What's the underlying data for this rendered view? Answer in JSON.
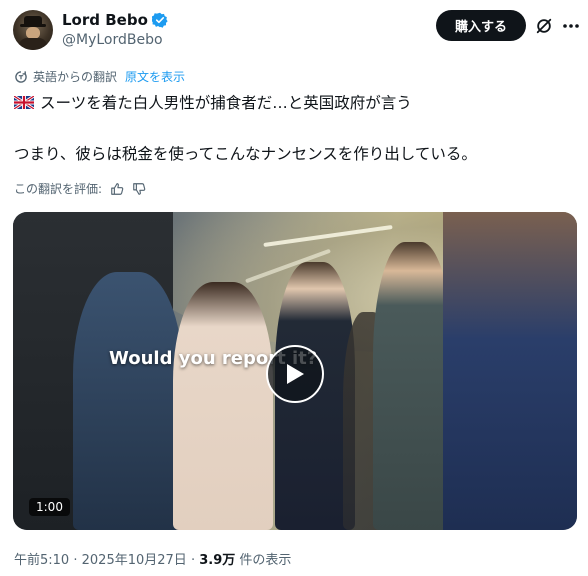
{
  "author": {
    "display_name": "Lord Bebo",
    "handle": "@MyLordBebo",
    "avatar_icon": "avatar-portrait",
    "verified_icon": "verified-badge-icon",
    "verified_color": "#1d9bf0"
  },
  "header": {
    "subscribe_label": "購入する",
    "grok_icon": "grok-icon",
    "more_icon": "more-options-icon"
  },
  "translation": {
    "label": "英語からの翻訳",
    "show_original": "原文を表示",
    "rate_label": "この翻訳を評価:"
  },
  "tweet": {
    "line1": "スーツを着た白人男性が捕食者だ…と英国政府が言う",
    "line2": "つまり、彼らは税金を使ってこんなナンセンスを作り出している。",
    "flag_icon": "uk-flag-icon"
  },
  "media": {
    "overlay_text": "Would you report it?",
    "duration": "1:00",
    "play_icon": "play-icon"
  },
  "meta": {
    "time": "午前5:10",
    "date": "2025年10月27日",
    "separator": "·",
    "views_count": "3.9万",
    "views_label": "件の表示"
  },
  "colors": {
    "accent": "#1d9bf0",
    "text_primary": "#0f1419",
    "text_secondary": "#536471",
    "button_bg": "#0f1419"
  }
}
